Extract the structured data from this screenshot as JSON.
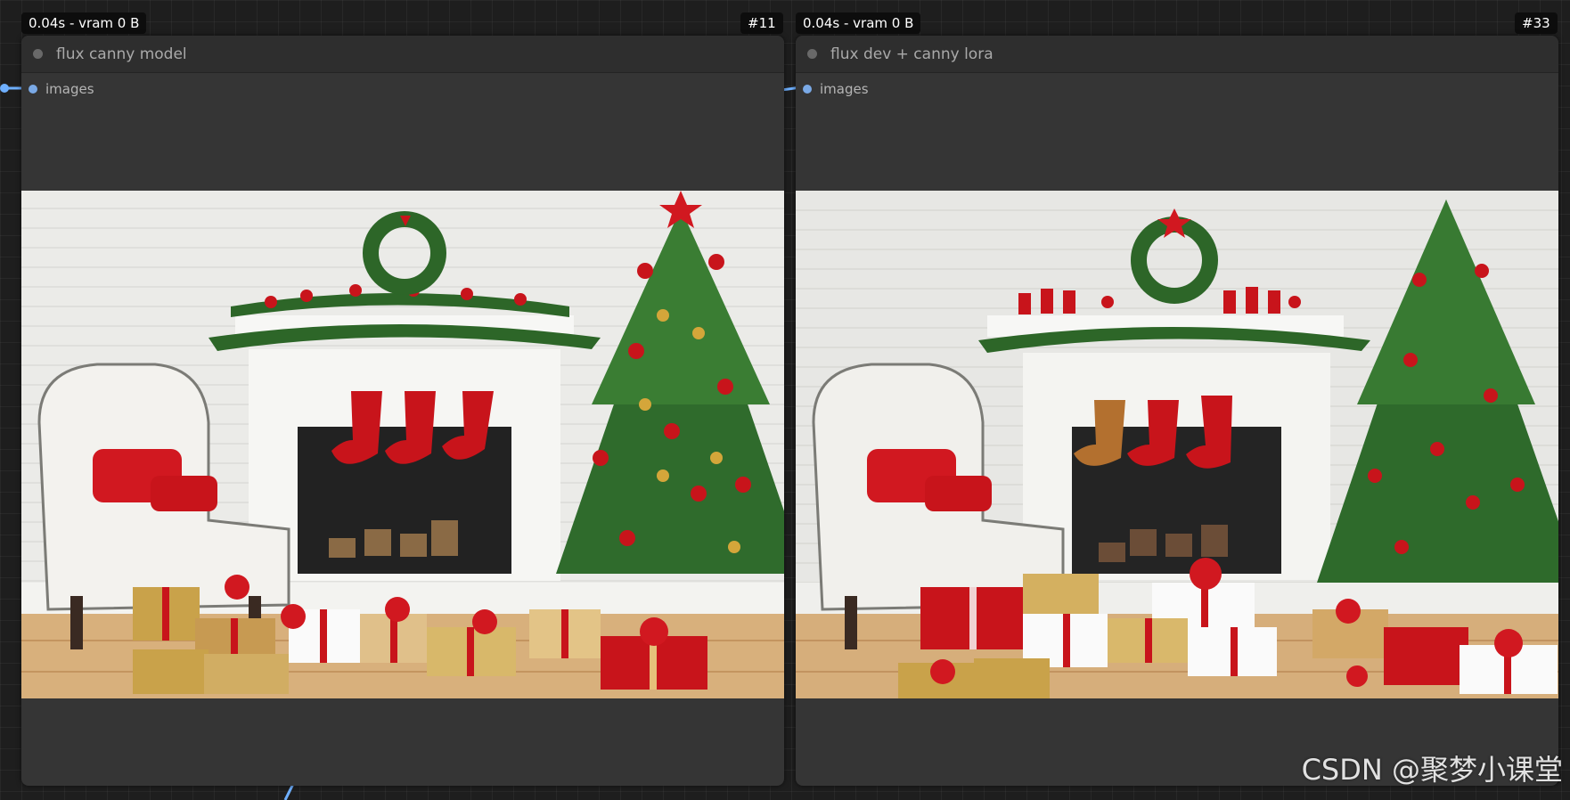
{
  "nodes": [
    {
      "timing": "0.04s - vram 0 B",
      "id": "#11",
      "title": "flux canny model",
      "input_slot": "images",
      "preview_icon": "christmas-scene-image"
    },
    {
      "timing": "0.04s - vram 0 B",
      "id": "#33",
      "title": "flux dev + canny lora",
      "input_slot": "images",
      "preview_icon": "christmas-scene-image"
    }
  ],
  "watermark": "CSDN @聚梦小课堂",
  "colors": {
    "canvas_bg": "#1e1e1e",
    "node_body": "#353535",
    "node_header": "#2e2e2e",
    "link_blue": "#6fb0ff",
    "wall": "#e9e9e6",
    "tree_green": "#2f6b2c",
    "ornament_red": "#c8141b",
    "floor_wood": "#d9b27f"
  }
}
